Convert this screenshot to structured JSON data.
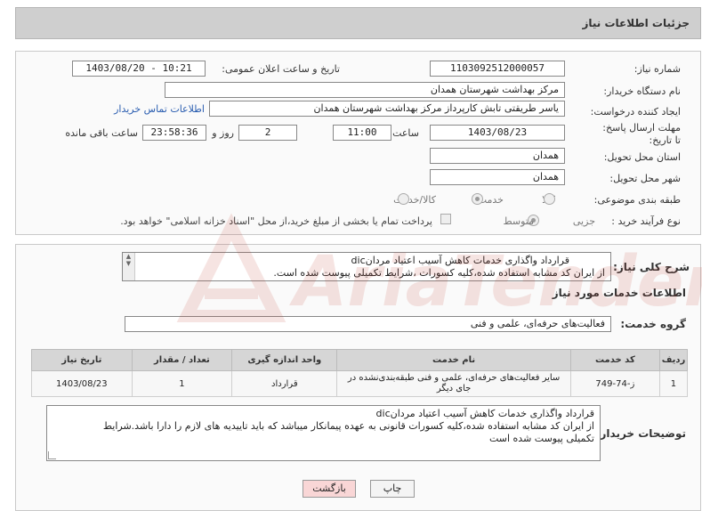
{
  "header": {
    "title": "جزئیات اطلاعات نیاز"
  },
  "form": {
    "need_number_label": "شماره نیاز:",
    "need_number": "1103092512000057",
    "announce_label": "تاریخ و ساعت اعلان عمومی:",
    "announce_value": "1403/08/20 - 10:21",
    "buyer_org_label": "نام دستگاه خریدار:",
    "buyer_org": "مرکز بهداشت شهرستان همدان",
    "creator_label": "ایجاد کننده درخواست:",
    "creator": "یاسر طریقتی تابش کارپرداز مرکز بهداشت شهرستان همدان",
    "contact_link": "اطلاعات تماس خریدار",
    "deadline_label": "مهلت ارسال پاسخ: تا تاریخ:",
    "deadline_date": "1403/08/23",
    "time_label": "ساعت",
    "deadline_time": "11:00",
    "days_value": "2",
    "days_label": "روز و",
    "remaining_time": "23:58:36",
    "remaining_label": "ساعت باقی مانده",
    "province_label": "استان محل تحویل:",
    "province": "همدان",
    "city_label": "شهر محل تحویل:",
    "city": "همدان",
    "category_label": "طبقه بندی موضوعی:",
    "category_options": [
      "کالا",
      "خدمت",
      "کالا/خدمت"
    ],
    "category_selected": "خدمت",
    "process_label": "نوع فرآیند خرید :",
    "process_options": [
      "جزیی",
      "متوسط"
    ],
    "process_selected": "جزیی",
    "treasury_note": "پرداخت تمام یا بخشی از مبلغ خرید،از محل \"اسناد خزانه اسلامی\" خواهد بود."
  },
  "summary": {
    "label": "شرح کلی نیاز:",
    "line1": "قرارداد واگذاری خدمات کاهش آسیب اعتیاد مردانdic",
    "line2": "از ایران کد مشابه استفاده شده،کلیه کسورات ،شرایط تکمیلی پیوست شده است."
  },
  "services": {
    "section_title": "اطلاعات خدمات مورد نیاز",
    "group_label": "گروه خدمت:",
    "group_value": "فعالیت‌های حرفه‌ای، علمی و فنی",
    "columns": [
      "ردیف",
      "کد خدمت",
      "نام خدمت",
      "واحد اندازه گیری",
      "تعداد / مقدار",
      "تاریخ نیاز"
    ],
    "rows": [
      {
        "index": "1",
        "code": "ز-74-749",
        "name": "سایر فعالیت‌های حرفه‌ای، علمی و فنی طبقه‌بندی‌نشده در جای دیگر",
        "unit": "قرارداد",
        "qty": "1",
        "date": "1403/08/23"
      }
    ]
  },
  "buyer_notes": {
    "label": "توضیحات خریدار:",
    "line1": "قرارداد واگذاری خدمات کاهش آسیب اعتیاد مردانdic",
    "line2": "از ایران کد مشابه استفاده شده،کلیه کسورات  قانونی به عهده پیمانکار میباشد  که باید تاییدیه های لازم را دارا باشد.شرایط",
    "line3": "تکمیلی پیوست شده است"
  },
  "buttons": {
    "print": "چاپ",
    "back": "بازگشت"
  },
  "watermark": {
    "text": "AriaTender.neT"
  },
  "colors": {
    "back_button_bg": "#f9d6d6",
    "print_button_bg": "#f4f4f4",
    "link": "#2a5db0",
    "watermark": "#c0392b"
  }
}
